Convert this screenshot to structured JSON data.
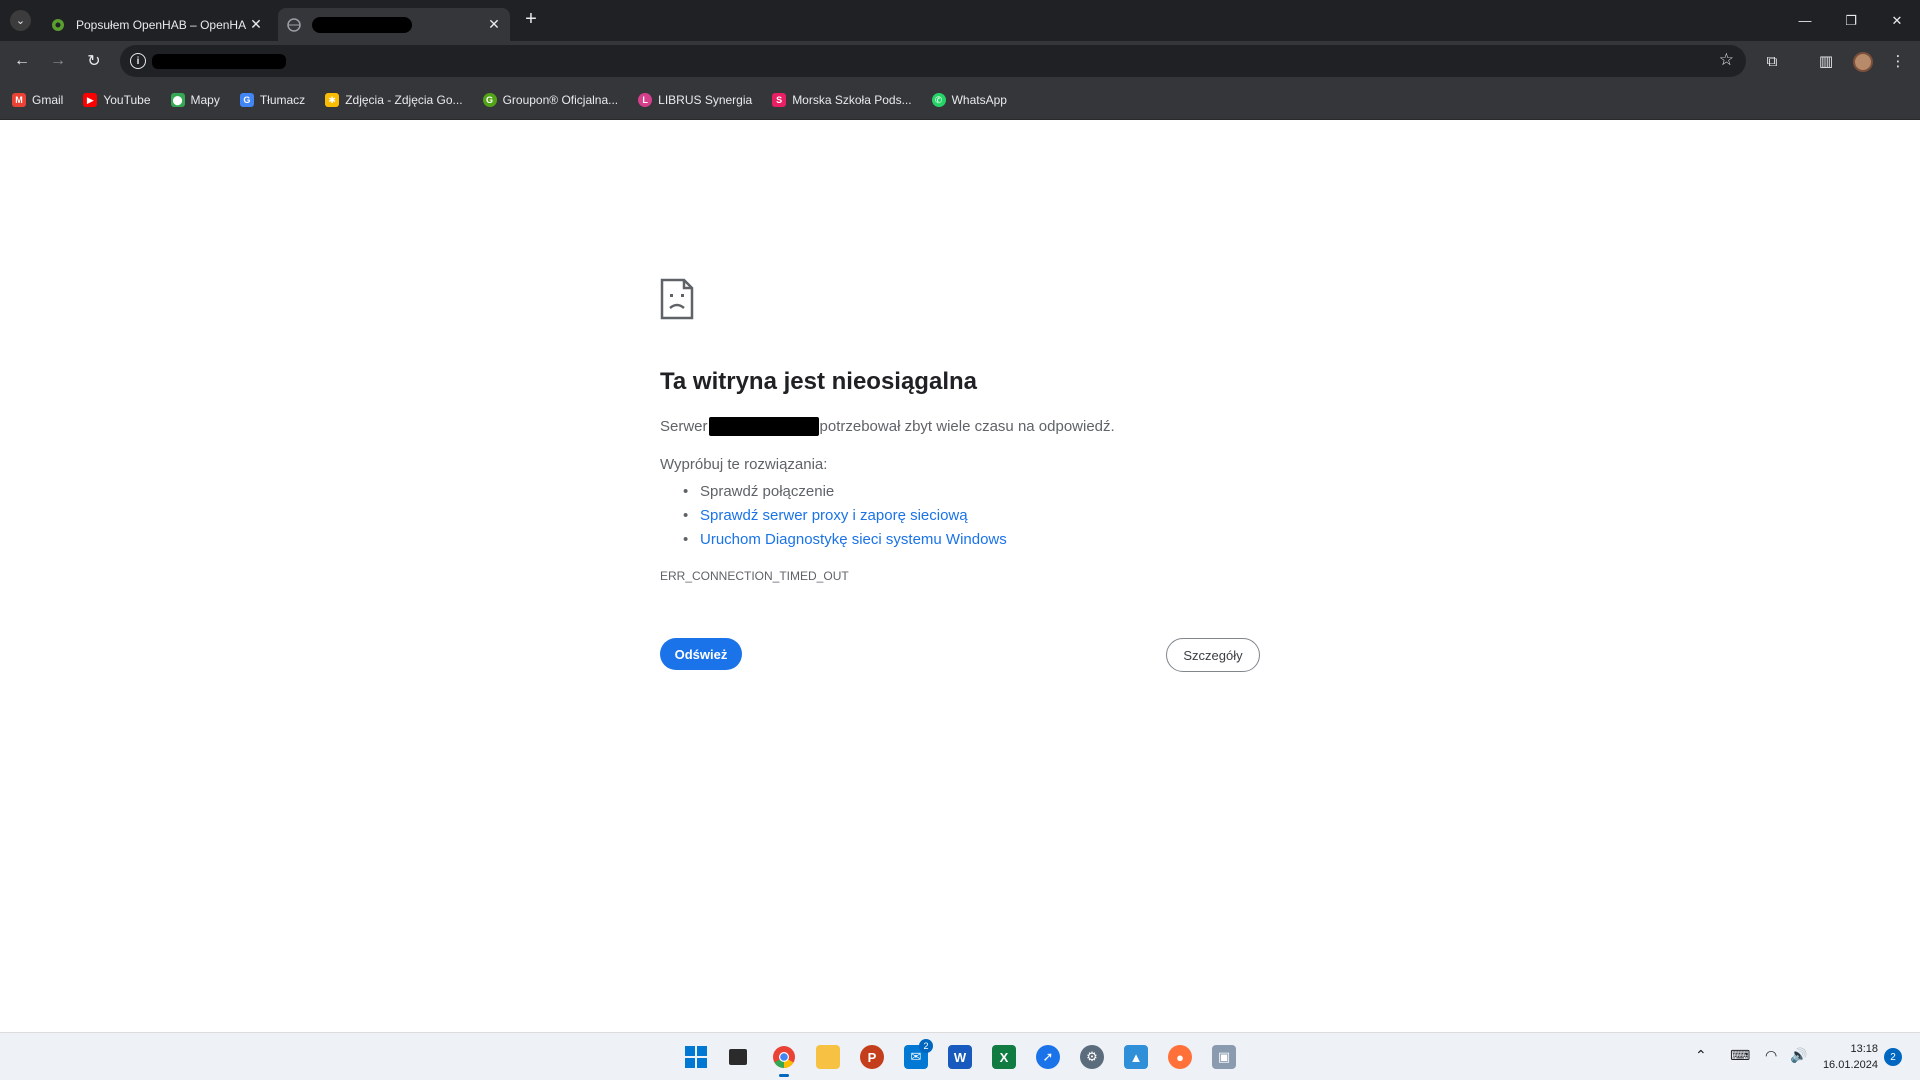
{
  "browser": {
    "tabs": [
      {
        "title": "Popsułem OpenHAB – OpenHA",
        "active": false
      },
      {
        "title": "",
        "active": true
      }
    ],
    "bookmarks": [
      {
        "label": "Gmail",
        "icon": "gmail-icon",
        "color": "#ea4335"
      },
      {
        "label": "YouTube",
        "icon": "youtube-icon",
        "color": "#ff0000"
      },
      {
        "label": "Mapy",
        "icon": "maps-icon",
        "color": "#34a853"
      },
      {
        "label": "Tłumacz",
        "icon": "translate-icon",
        "color": "#4285f4"
      },
      {
        "label": "Zdjęcia - Zdjęcia Go...",
        "icon": "photos-icon",
        "color": "#fbbc04"
      },
      {
        "label": "Groupon® Oficjalna...",
        "icon": "groupon-icon",
        "color": "#53a318"
      },
      {
        "label": "LIBRUS Synergia",
        "icon": "librus-icon",
        "color": "#d63f8c"
      },
      {
        "label": "Morska Szkoła Pods...",
        "icon": "school-icon",
        "color": "#e91e63"
      },
      {
        "label": "WhatsApp",
        "icon": "whatsapp-icon",
        "color": "#25d366"
      }
    ]
  },
  "error": {
    "title": "Ta witryna jest nieosiągalna",
    "desc_before": "Serwer",
    "desc_after": "potrzebował zbyt wiele czasu na odpowiedź.",
    "suggest_head": "Wypróbuj te rozwiązania:",
    "suggestions": [
      "Sprawdź połączenie",
      "Sprawdź serwer proxy i zaporę sieciową",
      "Uruchom Diagnostykę sieci systemu Windows"
    ],
    "code": "ERR_CONNECTION_TIMED_OUT",
    "reload_label": "Odśwież",
    "details_label": "Szczegóły"
  },
  "taskbar": {
    "mail_badge": "2",
    "time": "13:18",
    "date": "16.01.2024",
    "notifications": "2"
  },
  "colors": {
    "accent": "#1a73e8",
    "tab_strip": "#202124",
    "toolbar": "#35363a"
  }
}
